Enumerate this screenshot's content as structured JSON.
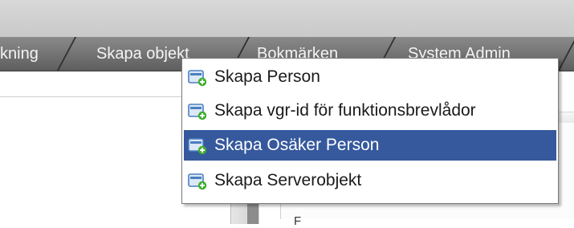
{
  "tabs": [
    {
      "label": "kning"
    },
    {
      "label": "Skapa objekt"
    },
    {
      "label": "Bokmärken"
    },
    {
      "label": "System Admin"
    }
  ],
  "menu": {
    "items": [
      {
        "label": "Skapa Person",
        "icon": "add-card-icon"
      },
      {
        "label": "Skapa vgr-id för funktionsbrevlådor",
        "icon": "add-card-icon"
      },
      {
        "label": "Skapa Osäker Person",
        "icon": "add-card-icon",
        "selected": true
      },
      {
        "label": "Skapa Serverobjekt",
        "icon": "add-card-icon"
      }
    ]
  },
  "content": {
    "right_fragment": "F"
  },
  "colors": {
    "tabbar": "#6e6e6e",
    "selection": "#36599d",
    "icon_blue": "#4a7fc1",
    "icon_green": "#3fae2f"
  }
}
